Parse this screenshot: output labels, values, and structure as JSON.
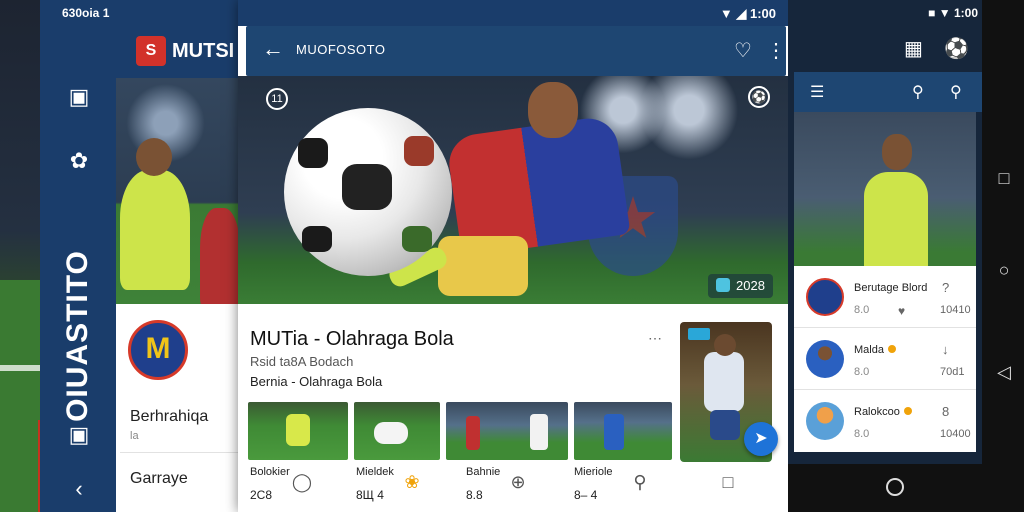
{
  "left_phone": {
    "status_time": "630ia 1",
    "status_text": "630oia 1",
    "app_title": "MUTSI",
    "logo_text": "S",
    "rail_title": "OIUASTITO",
    "badge_text": "M",
    "item1_title": "Berhrahiqa",
    "item1_sub": "la",
    "item2_title": "Garraye",
    "icons": [
      "gallery-icon",
      "group-icon",
      "camera-icon",
      "back-icon"
    ]
  },
  "center_phone": {
    "status_time": "1:00",
    "appbar_title": "MUOFOSOTO",
    "hero_count": "11",
    "hero_tag": "2028",
    "card_title": "MUTia - Olahraga Bola",
    "card_sub1": "Rsid ta8A Bodach",
    "card_sub2": "Bernia - Olahraga Bola",
    "thumbs": [
      {
        "label": "Bolokier",
        "value": "2C8"
      },
      {
        "label": "Mieldek",
        "value": "8Щ 4"
      },
      {
        "label": "Bahnie",
        "value": "8.8"
      },
      {
        "label": "Mieriole",
        "value": "8– 4"
      }
    ],
    "nav": [
      "controller-icon",
      "trophy-icon",
      "add-icon",
      "search-icon",
      "bookmark-icon"
    ]
  },
  "right_phone": {
    "status_time": "1:00",
    "list": [
      {
        "name": "Berutage Blord",
        "value": "8.0",
        "side": "?",
        "side2": "10410",
        "accent": false
      },
      {
        "name": "Malda",
        "value": "8.0",
        "side": "↓",
        "side2": "70d1",
        "accent": true
      },
      {
        "name": "Ralokcoo",
        "value": "8.0",
        "side": "8",
        "side2": "10400",
        "accent": true
      }
    ]
  }
}
